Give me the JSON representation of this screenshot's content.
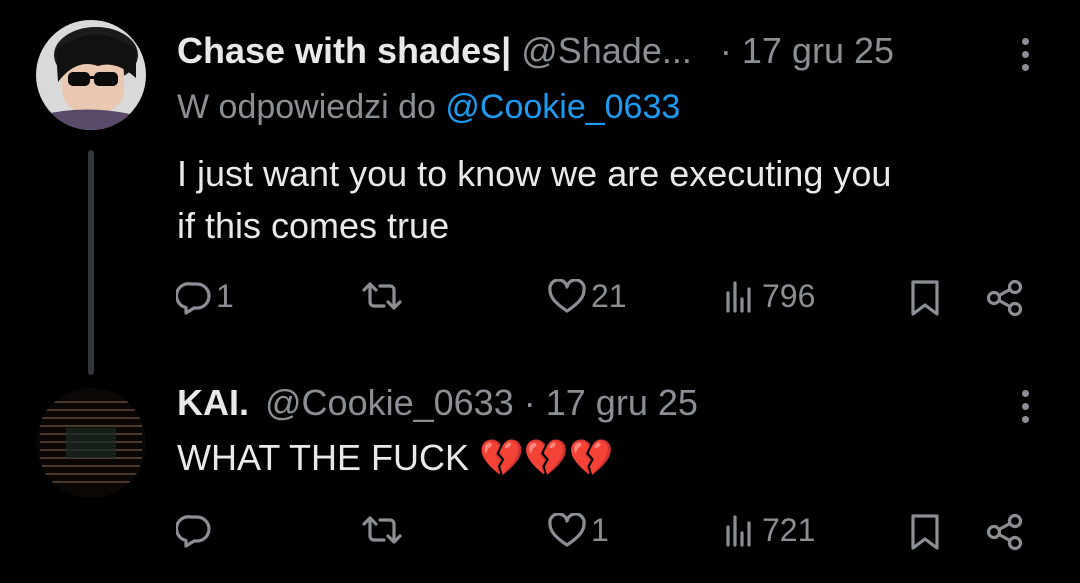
{
  "tweets": [
    {
      "name": "Chase with shades|",
      "handle": "@Shade...",
      "dot": "·",
      "time": "17 gru 25",
      "reply_prefix": "W odpowiedzi do",
      "reply_mention": "@Cookie_0633",
      "text_line1": "I just want you to know we are executing you",
      "text_line2": "if this comes true",
      "replies": "1",
      "retweets": "",
      "likes": "21",
      "views": "796"
    },
    {
      "name": "KAI.",
      "handle": "@Cookie_0633",
      "dot": "·",
      "time": "17 gru 25",
      "text_line1": "WHAT THE FUCK",
      "emoji": "💔💔💔",
      "replies": "",
      "retweets": "",
      "likes": "1",
      "views": "721"
    }
  ],
  "colors": {
    "background": "#000000",
    "text": "#e7e9ea",
    "muted": "#8b8f94",
    "link": "#1d9bf0",
    "heart": "#e0245e"
  },
  "icons": [
    "reply-icon",
    "retweet-icon",
    "like-icon",
    "views-icon",
    "bookmark-icon",
    "share-icon",
    "more-icon"
  ]
}
